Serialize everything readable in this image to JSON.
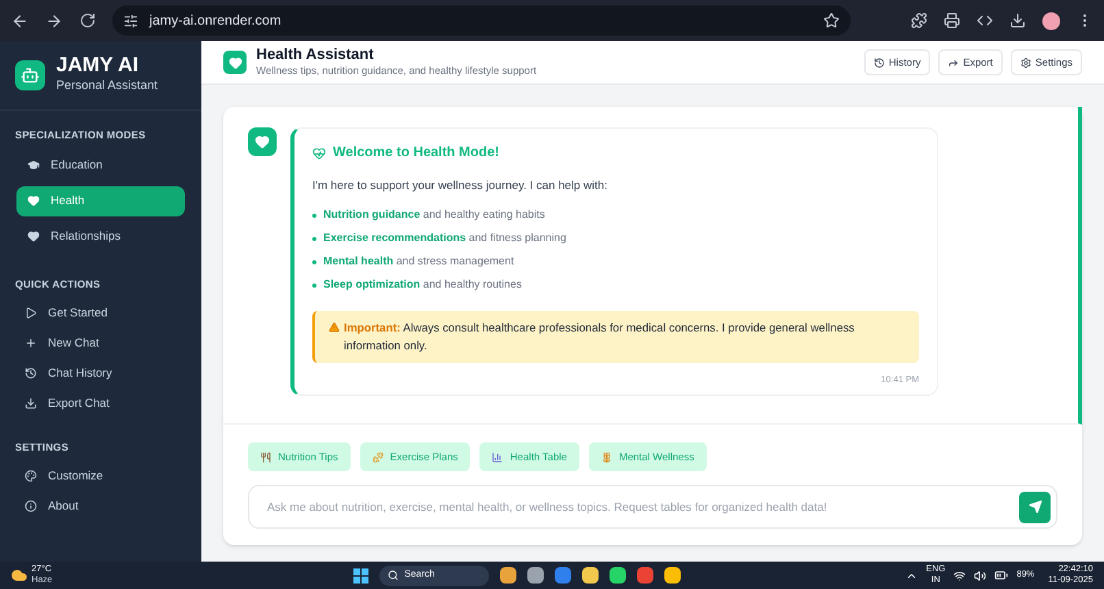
{
  "browser": {
    "url": "jamy-ai.onrender.com"
  },
  "sidebar": {
    "brand": "JAMY AI",
    "tagline": "Personal Assistant",
    "sections": [
      {
        "title": "SPECIALIZATION MODES",
        "items": [
          {
            "label": "Education",
            "selected": false
          },
          {
            "label": "Health",
            "selected": true
          },
          {
            "label": "Relationships",
            "selected": false
          }
        ]
      },
      {
        "title": "QUICK ACTIONS",
        "items": [
          {
            "label": "Get Started"
          },
          {
            "label": "New Chat"
          },
          {
            "label": "Chat History"
          },
          {
            "label": "Export Chat"
          }
        ]
      },
      {
        "title": "SETTINGS",
        "items": [
          {
            "label": "Customize"
          },
          {
            "label": "About"
          }
        ]
      }
    ]
  },
  "header": {
    "title": "Health Assistant",
    "subtitle": "Wellness tips, nutrition guidance, and healthy lifestyle support",
    "buttons": [
      "History",
      "Export",
      "Settings"
    ]
  },
  "message": {
    "title": "Welcome to Health Mode!",
    "intro": "I'm here to support your wellness journey. I can help with:",
    "points": [
      "**Nutrition guidance** and healthy eating habits",
      "**Exercise recommendations** and fitness planning",
      "**Mental health** and stress management",
      "**Sleep optimization** and healthy routines"
    ],
    "note": "**Important:** Always consult healthcare professionals for medical concerns. I provide general wellness information only.",
    "time": "10:41 PM"
  },
  "chips": [
    "Nutrition Tips",
    "Exercise Plans",
    "Health Table",
    "Mental Wellness"
  ],
  "input": {
    "placeholder": "Ask me about nutrition, exercise, mental health, or wellness topics. Request tables for organized health data!"
  },
  "taskbar": {
    "temperature": "27°C",
    "weather": "Haze",
    "search": "Search",
    "language": "ENG",
    "region": "IN",
    "battery": "89%",
    "time": "22:42:10",
    "date": "11-09-2025"
  }
}
